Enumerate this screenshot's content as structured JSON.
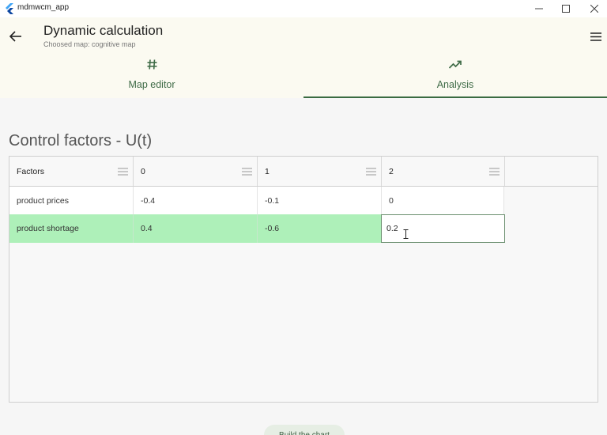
{
  "window": {
    "title": "mdmwcm_app"
  },
  "header": {
    "title": "Dynamic calculation",
    "subtitle": "Choosed map: cognitive map"
  },
  "tabs": [
    {
      "label": "Map editor",
      "icon": "hash-icon"
    },
    {
      "label": "Analysis",
      "icon": "trending-up-icon",
      "active": true
    }
  ],
  "section": {
    "heading": "Control factors - U(t)"
  },
  "table": {
    "columns": [
      "Factors",
      "0",
      "1",
      "2"
    ],
    "rows": [
      {
        "cells": [
          "product prices",
          "-0.4",
          "-0.1",
          "0"
        ]
      },
      {
        "cells": [
          "product shortage",
          "0.4",
          "-0.6",
          "0.2"
        ],
        "selected": true
      }
    ]
  },
  "actions": {
    "build_chart": "Build the chart"
  },
  "colors": {
    "accent": "#3a6b42",
    "selected_row": "#aef0b9",
    "header_bg": "#fbfaf1"
  }
}
